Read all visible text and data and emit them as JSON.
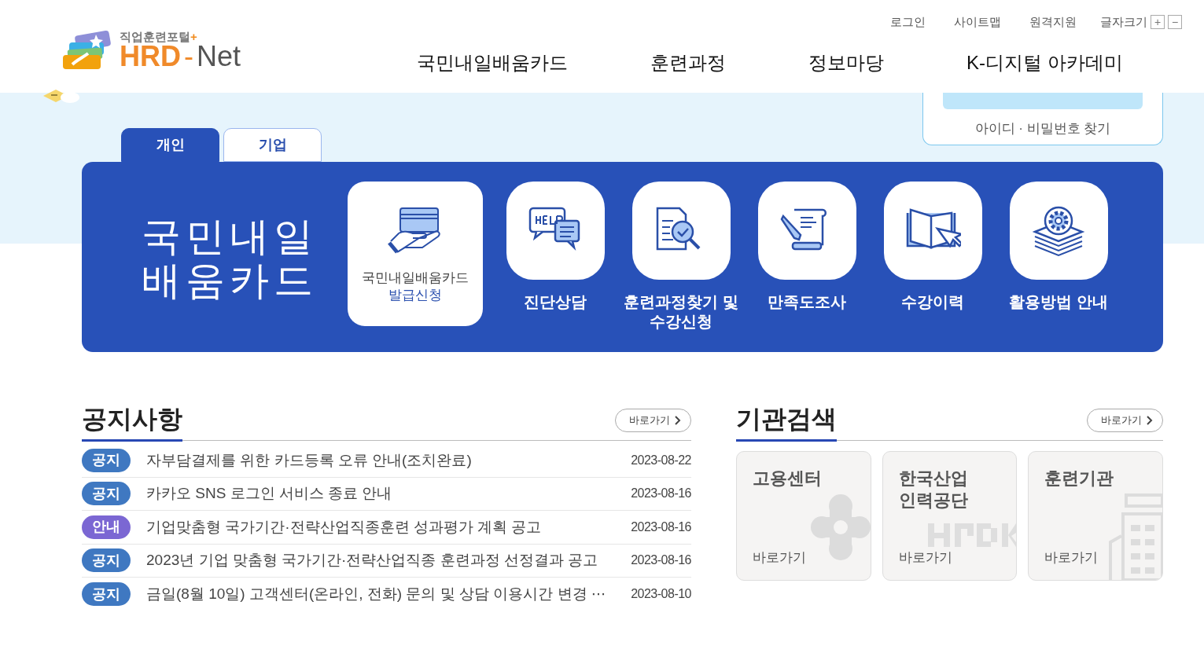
{
  "logo": {
    "tagline": "직업훈련포털",
    "plus": "+",
    "name_main": "HRD",
    "name_dash": "-",
    "name_end": "Net"
  },
  "utility_links": [
    "로그인",
    "사이트맵",
    "원격지원"
  ],
  "font_size": {
    "label": "글자크기",
    "increase": "+",
    "decrease": "−"
  },
  "nav": [
    "국민내일배움카드",
    "훈련과정",
    "정보마당",
    "K-디지털 아카데미"
  ],
  "login_panel": {
    "find_link": "아이디 · 비밀번호 찾기"
  },
  "tabs": [
    {
      "label": "개인",
      "selected": true
    },
    {
      "label": "기업",
      "selected": false
    }
  ],
  "card_panel": {
    "title_lines": [
      "국민내일",
      "배움카드"
    ],
    "items": [
      {
        "kind": "card",
        "label": "국민내일배움카드",
        "sublabel": "발급신청"
      },
      {
        "kind": "tile",
        "label": "진단상담"
      },
      {
        "kind": "tile",
        "label": "훈련과정찾기 및 수강신청"
      },
      {
        "kind": "tile",
        "label": "만족도조사"
      },
      {
        "kind": "tile",
        "label": "수강이력"
      },
      {
        "kind": "tile",
        "label": "활용방법 안내"
      }
    ]
  },
  "notices": {
    "title": "공지사항",
    "more": "바로가기",
    "rows": [
      {
        "tag": "공지",
        "color": "#3f78c1",
        "text": "자부담결제를 위한 카드등록 오류 안내(조치완료)",
        "date": "2023-08-22"
      },
      {
        "tag": "공지",
        "color": "#3f78c1",
        "text": "카카오 SNS 로그인 서비스 종료 안내",
        "date": "2023-08-16"
      },
      {
        "tag": "안내",
        "color": "#7b67d3",
        "text": "기업맞춤형 국가기간·전략산업직종훈련 성과평가 계획 공고",
        "date": "2023-08-16"
      },
      {
        "tag": "공지",
        "color": "#3f78c1",
        "text": "2023년 기업 맞춤형 국가기간·전략산업직종 훈련과정 선정결과 공고",
        "date": "2023-08-16"
      },
      {
        "tag": "공지",
        "color": "#3f78c1",
        "text": "금일(8월 10일) 고객센터(온라인, 전화) 문의 및 상담 이용시간 변경 ⋯",
        "date": "2023-08-10"
      }
    ]
  },
  "agency_search": {
    "title": "기관검색",
    "more": "바로가기",
    "cards": [
      {
        "title_lines": [
          "고용센터"
        ],
        "link": "바로가기"
      },
      {
        "title_lines": [
          "한국산업",
          "인력공단"
        ],
        "link": "바로가기"
      },
      {
        "title_lines": [
          "훈련기관"
        ],
        "link": "바로가기"
      }
    ]
  }
}
